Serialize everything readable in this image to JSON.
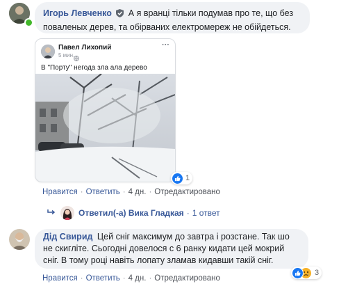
{
  "comment1": {
    "author": "Игорь Левченко",
    "text": "А я вранці тільки подумав про те, що без поваленых дерев, та обірваних електромереж не обійдеться.",
    "shared_post": {
      "author": "Павел Лихопий",
      "time": "5 мин.",
      "menu": "···",
      "text": "В \"Порту\" негода зла ала дерево"
    },
    "reaction_count": "1",
    "actions": {
      "like": "Нравится",
      "reply": "Ответить",
      "time": "4 дн.",
      "edited": "Отредактировано"
    }
  },
  "reply_summary": {
    "text": "Ответил(-а) Вика Гладкая",
    "count": "1 ответ"
  },
  "comment2": {
    "author": "Дід Свирид",
    "lines": [
      "Цей сніг максимум до завтра і розстане. Так шо",
      "не скигліте. Сьогодні довелося с 6 ранку кидати цей мокрий",
      "сніг. В тому році навіть лопату зламав кидавши такій сніг."
    ],
    "reaction_count": "3",
    "actions": {
      "like": "Нравится",
      "reply": "Ответить",
      "time": "4 дн.",
      "edited": "Отредактировано"
    }
  },
  "colors": {
    "link": "#385898",
    "bubble": "#f0f2f5",
    "like_blue": "#1877f2",
    "online_green": "#42b72a"
  }
}
